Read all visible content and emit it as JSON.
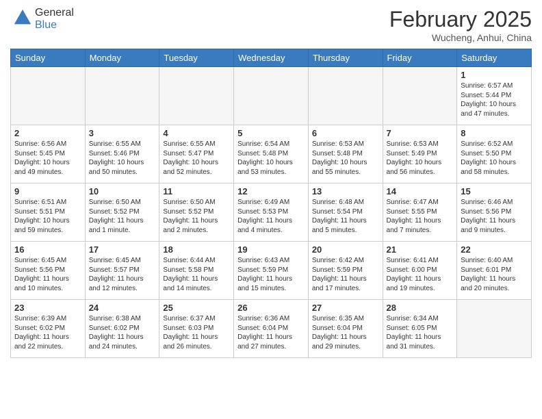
{
  "header": {
    "logo_general": "General",
    "logo_blue": "Blue",
    "month_title": "February 2025",
    "subtitle": "Wucheng, Anhui, China"
  },
  "days_of_week": [
    "Sunday",
    "Monday",
    "Tuesday",
    "Wednesday",
    "Thursday",
    "Friday",
    "Saturday"
  ],
  "weeks": [
    [
      {
        "day": "",
        "info": ""
      },
      {
        "day": "",
        "info": ""
      },
      {
        "day": "",
        "info": ""
      },
      {
        "day": "",
        "info": ""
      },
      {
        "day": "",
        "info": ""
      },
      {
        "day": "",
        "info": ""
      },
      {
        "day": "1",
        "info": "Sunrise: 6:57 AM\nSunset: 5:44 PM\nDaylight: 10 hours and 47 minutes."
      }
    ],
    [
      {
        "day": "2",
        "info": "Sunrise: 6:56 AM\nSunset: 5:45 PM\nDaylight: 10 hours and 49 minutes."
      },
      {
        "day": "3",
        "info": "Sunrise: 6:55 AM\nSunset: 5:46 PM\nDaylight: 10 hours and 50 minutes."
      },
      {
        "day": "4",
        "info": "Sunrise: 6:55 AM\nSunset: 5:47 PM\nDaylight: 10 hours and 52 minutes."
      },
      {
        "day": "5",
        "info": "Sunrise: 6:54 AM\nSunset: 5:48 PM\nDaylight: 10 hours and 53 minutes."
      },
      {
        "day": "6",
        "info": "Sunrise: 6:53 AM\nSunset: 5:48 PM\nDaylight: 10 hours and 55 minutes."
      },
      {
        "day": "7",
        "info": "Sunrise: 6:53 AM\nSunset: 5:49 PM\nDaylight: 10 hours and 56 minutes."
      },
      {
        "day": "8",
        "info": "Sunrise: 6:52 AM\nSunset: 5:50 PM\nDaylight: 10 hours and 58 minutes."
      }
    ],
    [
      {
        "day": "9",
        "info": "Sunrise: 6:51 AM\nSunset: 5:51 PM\nDaylight: 10 hours and 59 minutes."
      },
      {
        "day": "10",
        "info": "Sunrise: 6:50 AM\nSunset: 5:52 PM\nDaylight: 11 hours and 1 minute."
      },
      {
        "day": "11",
        "info": "Sunrise: 6:50 AM\nSunset: 5:52 PM\nDaylight: 11 hours and 2 minutes."
      },
      {
        "day": "12",
        "info": "Sunrise: 6:49 AM\nSunset: 5:53 PM\nDaylight: 11 hours and 4 minutes."
      },
      {
        "day": "13",
        "info": "Sunrise: 6:48 AM\nSunset: 5:54 PM\nDaylight: 11 hours and 5 minutes."
      },
      {
        "day": "14",
        "info": "Sunrise: 6:47 AM\nSunset: 5:55 PM\nDaylight: 11 hours and 7 minutes."
      },
      {
        "day": "15",
        "info": "Sunrise: 6:46 AM\nSunset: 5:56 PM\nDaylight: 11 hours and 9 minutes."
      }
    ],
    [
      {
        "day": "16",
        "info": "Sunrise: 6:45 AM\nSunset: 5:56 PM\nDaylight: 11 hours and 10 minutes."
      },
      {
        "day": "17",
        "info": "Sunrise: 6:45 AM\nSunset: 5:57 PM\nDaylight: 11 hours and 12 minutes."
      },
      {
        "day": "18",
        "info": "Sunrise: 6:44 AM\nSunset: 5:58 PM\nDaylight: 11 hours and 14 minutes."
      },
      {
        "day": "19",
        "info": "Sunrise: 6:43 AM\nSunset: 5:59 PM\nDaylight: 11 hours and 15 minutes."
      },
      {
        "day": "20",
        "info": "Sunrise: 6:42 AM\nSunset: 5:59 PM\nDaylight: 11 hours and 17 minutes."
      },
      {
        "day": "21",
        "info": "Sunrise: 6:41 AM\nSunset: 6:00 PM\nDaylight: 11 hours and 19 minutes."
      },
      {
        "day": "22",
        "info": "Sunrise: 6:40 AM\nSunset: 6:01 PM\nDaylight: 11 hours and 20 minutes."
      }
    ],
    [
      {
        "day": "23",
        "info": "Sunrise: 6:39 AM\nSunset: 6:02 PM\nDaylight: 11 hours and 22 minutes."
      },
      {
        "day": "24",
        "info": "Sunrise: 6:38 AM\nSunset: 6:02 PM\nDaylight: 11 hours and 24 minutes."
      },
      {
        "day": "25",
        "info": "Sunrise: 6:37 AM\nSunset: 6:03 PM\nDaylight: 11 hours and 26 minutes."
      },
      {
        "day": "26",
        "info": "Sunrise: 6:36 AM\nSunset: 6:04 PM\nDaylight: 11 hours and 27 minutes."
      },
      {
        "day": "27",
        "info": "Sunrise: 6:35 AM\nSunset: 6:04 PM\nDaylight: 11 hours and 29 minutes."
      },
      {
        "day": "28",
        "info": "Sunrise: 6:34 AM\nSunset: 6:05 PM\nDaylight: 11 hours and 31 minutes."
      },
      {
        "day": "",
        "info": ""
      }
    ]
  ]
}
